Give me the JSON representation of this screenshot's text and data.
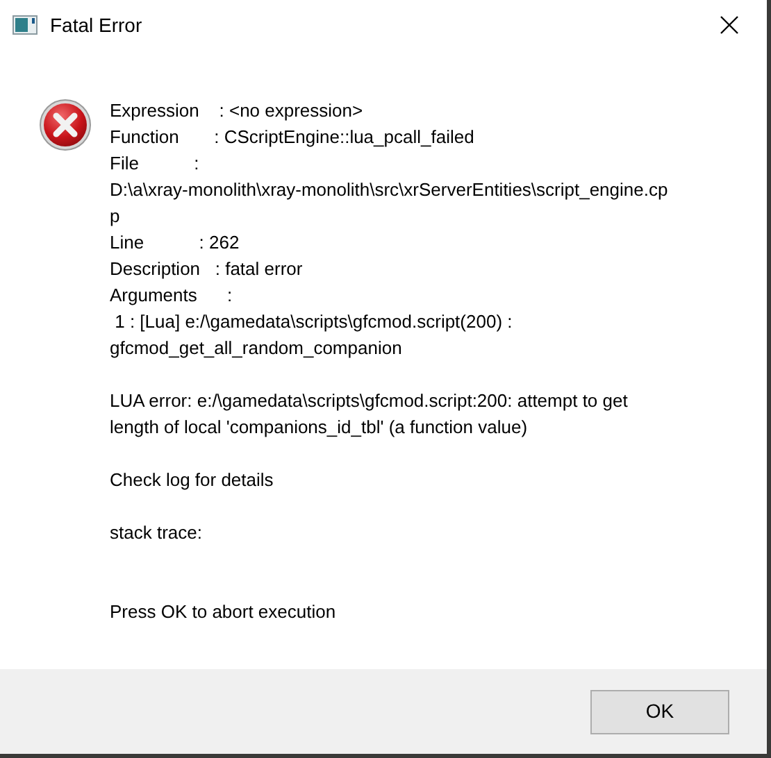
{
  "window": {
    "title": "Fatal Error"
  },
  "message": [
    {
      "lines": [
        "Expression    : <no expression>",
        "Function       : CScriptEngine::lua_pcall_failed",
        "File           :",
        "D:\\a\\xray-monolith\\xray-monolith\\src\\xrServerEntities\\script_engine.cp",
        "p",
        "Line           : 262",
        "Description   : fatal error",
        "Arguments      :",
        " 1 : [Lua] e:/\\gamedata\\scripts\\gfcmod.script(200) :",
        "gfcmod_get_all_random_companion"
      ]
    },
    {
      "lines": [
        "LUA error: e:/\\gamedata\\scripts\\gfcmod.script:200: attempt to get",
        "length of local 'companions_id_tbl' (a function value)"
      ]
    },
    {
      "lines": [
        "Check log for details"
      ]
    },
    {
      "lines": [
        "stack trace:"
      ]
    },
    {
      "lines": [
        "Press OK to abort execution"
      ]
    }
  ],
  "buttons": [
    "OK"
  ]
}
